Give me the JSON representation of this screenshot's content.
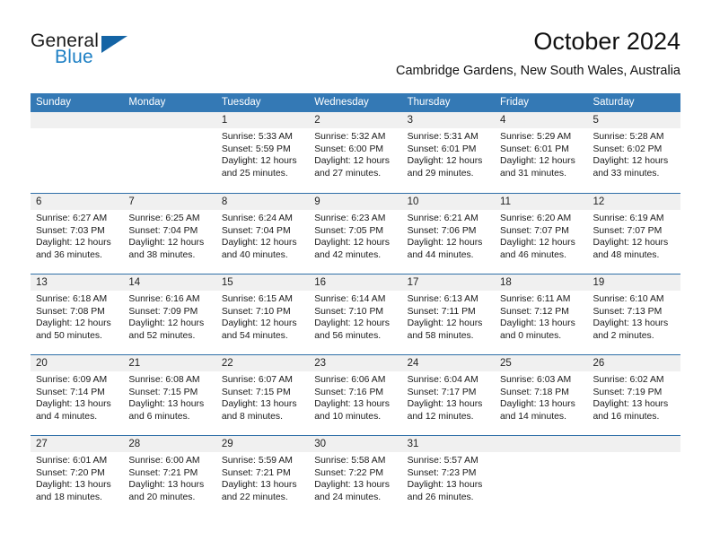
{
  "brand": {
    "name_part1": "General",
    "name_part2": "Blue"
  },
  "header": {
    "month_title": "October 2024",
    "location": "Cambridge Gardens, New South Wales, Australia"
  },
  "colors": {
    "header_blue": "#3479b5",
    "row_rule_blue": "#2f6fa8",
    "day_band_gray": "#f0f0f0",
    "brand_blue": "#1c7fc4",
    "logo_triangle": "#1464a5"
  },
  "weekdays": [
    "Sunday",
    "Monday",
    "Tuesday",
    "Wednesday",
    "Thursday",
    "Friday",
    "Saturday"
  ],
  "weeks": [
    [
      {
        "day": "",
        "lines": []
      },
      {
        "day": "",
        "lines": []
      },
      {
        "day": "1",
        "lines": [
          "Sunrise: 5:33 AM",
          "Sunset: 5:59 PM",
          "Daylight: 12 hours",
          "and 25 minutes."
        ]
      },
      {
        "day": "2",
        "lines": [
          "Sunrise: 5:32 AM",
          "Sunset: 6:00 PM",
          "Daylight: 12 hours",
          "and 27 minutes."
        ]
      },
      {
        "day": "3",
        "lines": [
          "Sunrise: 5:31 AM",
          "Sunset: 6:01 PM",
          "Daylight: 12 hours",
          "and 29 minutes."
        ]
      },
      {
        "day": "4",
        "lines": [
          "Sunrise: 5:29 AM",
          "Sunset: 6:01 PM",
          "Daylight: 12 hours",
          "and 31 minutes."
        ]
      },
      {
        "day": "5",
        "lines": [
          "Sunrise: 5:28 AM",
          "Sunset: 6:02 PM",
          "Daylight: 12 hours",
          "and 33 minutes."
        ]
      }
    ],
    [
      {
        "day": "6",
        "lines": [
          "Sunrise: 6:27 AM",
          "Sunset: 7:03 PM",
          "Daylight: 12 hours",
          "and 36 minutes."
        ]
      },
      {
        "day": "7",
        "lines": [
          "Sunrise: 6:25 AM",
          "Sunset: 7:04 PM",
          "Daylight: 12 hours",
          "and 38 minutes."
        ]
      },
      {
        "day": "8",
        "lines": [
          "Sunrise: 6:24 AM",
          "Sunset: 7:04 PM",
          "Daylight: 12 hours",
          "and 40 minutes."
        ]
      },
      {
        "day": "9",
        "lines": [
          "Sunrise: 6:23 AM",
          "Sunset: 7:05 PM",
          "Daylight: 12 hours",
          "and 42 minutes."
        ]
      },
      {
        "day": "10",
        "lines": [
          "Sunrise: 6:21 AM",
          "Sunset: 7:06 PM",
          "Daylight: 12 hours",
          "and 44 minutes."
        ]
      },
      {
        "day": "11",
        "lines": [
          "Sunrise: 6:20 AM",
          "Sunset: 7:07 PM",
          "Daylight: 12 hours",
          "and 46 minutes."
        ]
      },
      {
        "day": "12",
        "lines": [
          "Sunrise: 6:19 AM",
          "Sunset: 7:07 PM",
          "Daylight: 12 hours",
          "and 48 minutes."
        ]
      }
    ],
    [
      {
        "day": "13",
        "lines": [
          "Sunrise: 6:18 AM",
          "Sunset: 7:08 PM",
          "Daylight: 12 hours",
          "and 50 minutes."
        ]
      },
      {
        "day": "14",
        "lines": [
          "Sunrise: 6:16 AM",
          "Sunset: 7:09 PM",
          "Daylight: 12 hours",
          "and 52 minutes."
        ]
      },
      {
        "day": "15",
        "lines": [
          "Sunrise: 6:15 AM",
          "Sunset: 7:10 PM",
          "Daylight: 12 hours",
          "and 54 minutes."
        ]
      },
      {
        "day": "16",
        "lines": [
          "Sunrise: 6:14 AM",
          "Sunset: 7:10 PM",
          "Daylight: 12 hours",
          "and 56 minutes."
        ]
      },
      {
        "day": "17",
        "lines": [
          "Sunrise: 6:13 AM",
          "Sunset: 7:11 PM",
          "Daylight: 12 hours",
          "and 58 minutes."
        ]
      },
      {
        "day": "18",
        "lines": [
          "Sunrise: 6:11 AM",
          "Sunset: 7:12 PM",
          "Daylight: 13 hours",
          "and 0 minutes."
        ]
      },
      {
        "day": "19",
        "lines": [
          "Sunrise: 6:10 AM",
          "Sunset: 7:13 PM",
          "Daylight: 13 hours",
          "and 2 minutes."
        ]
      }
    ],
    [
      {
        "day": "20",
        "lines": [
          "Sunrise: 6:09 AM",
          "Sunset: 7:14 PM",
          "Daylight: 13 hours",
          "and 4 minutes."
        ]
      },
      {
        "day": "21",
        "lines": [
          "Sunrise: 6:08 AM",
          "Sunset: 7:15 PM",
          "Daylight: 13 hours",
          "and 6 minutes."
        ]
      },
      {
        "day": "22",
        "lines": [
          "Sunrise: 6:07 AM",
          "Sunset: 7:15 PM",
          "Daylight: 13 hours",
          "and 8 minutes."
        ]
      },
      {
        "day": "23",
        "lines": [
          "Sunrise: 6:06 AM",
          "Sunset: 7:16 PM",
          "Daylight: 13 hours",
          "and 10 minutes."
        ]
      },
      {
        "day": "24",
        "lines": [
          "Sunrise: 6:04 AM",
          "Sunset: 7:17 PM",
          "Daylight: 13 hours",
          "and 12 minutes."
        ]
      },
      {
        "day": "25",
        "lines": [
          "Sunrise: 6:03 AM",
          "Sunset: 7:18 PM",
          "Daylight: 13 hours",
          "and 14 minutes."
        ]
      },
      {
        "day": "26",
        "lines": [
          "Sunrise: 6:02 AM",
          "Sunset: 7:19 PM",
          "Daylight: 13 hours",
          "and 16 minutes."
        ]
      }
    ],
    [
      {
        "day": "27",
        "lines": [
          "Sunrise: 6:01 AM",
          "Sunset: 7:20 PM",
          "Daylight: 13 hours",
          "and 18 minutes."
        ]
      },
      {
        "day": "28",
        "lines": [
          "Sunrise: 6:00 AM",
          "Sunset: 7:21 PM",
          "Daylight: 13 hours",
          "and 20 minutes."
        ]
      },
      {
        "day": "29",
        "lines": [
          "Sunrise: 5:59 AM",
          "Sunset: 7:21 PM",
          "Daylight: 13 hours",
          "and 22 minutes."
        ]
      },
      {
        "day": "30",
        "lines": [
          "Sunrise: 5:58 AM",
          "Sunset: 7:22 PM",
          "Daylight: 13 hours",
          "and 24 minutes."
        ]
      },
      {
        "day": "31",
        "lines": [
          "Sunrise: 5:57 AM",
          "Sunset: 7:23 PM",
          "Daylight: 13 hours",
          "and 26 minutes."
        ]
      },
      {
        "day": "",
        "lines": []
      },
      {
        "day": "",
        "lines": []
      }
    ]
  ]
}
